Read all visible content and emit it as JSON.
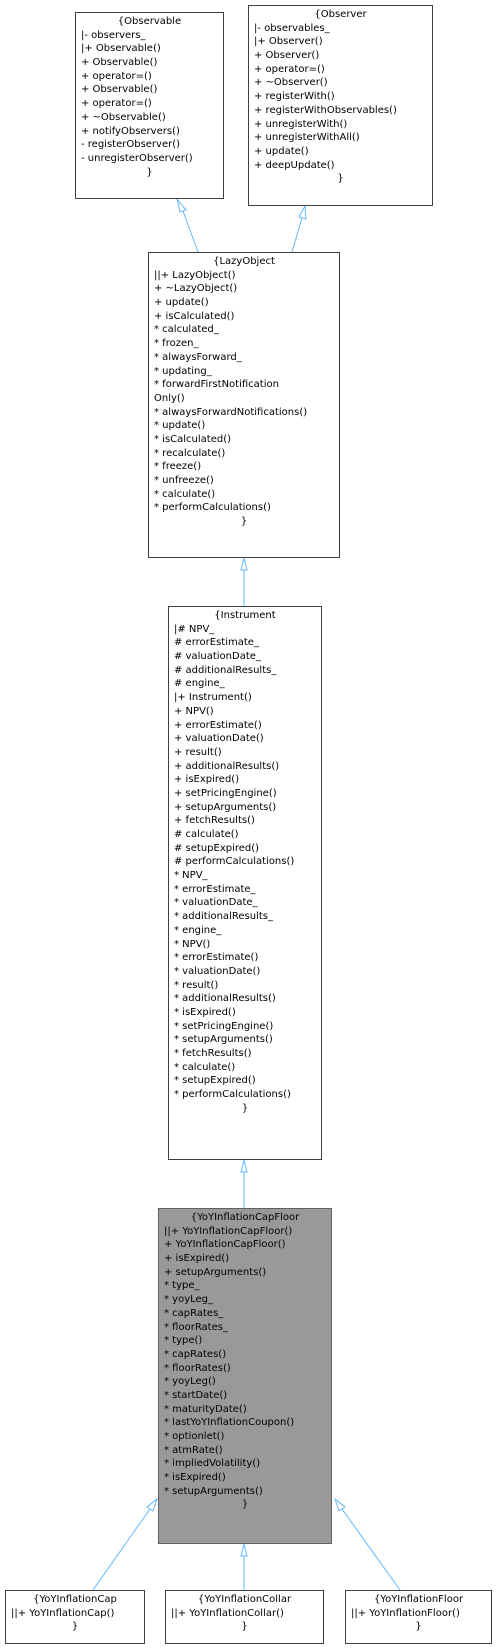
{
  "diagram": {
    "nodes": [
      {
        "id": "observable",
        "title": "{Observable",
        "members": [
          "|- observers_",
          "|+ Observable()",
          "+ Observable()",
          "+ operator=()",
          "+ Observable()",
          "+ operator=()",
          "+ ~Observable()",
          "+ notifyObservers()",
          "- registerObserver()",
          "- unregisterObserver()"
        ],
        "closer": "}"
      },
      {
        "id": "observer",
        "title": "{Observer",
        "members": [
          "|- observables_",
          "|+ Observer()",
          "+ Observer()",
          "+ operator=()",
          "+ ~Observer()",
          "+ registerWith()",
          "+ registerWithObservables()",
          "+ unregisterWith()",
          "+ unregisterWithAll()",
          "+ update()",
          "+ deepUpdate()"
        ],
        "closer": "}"
      },
      {
        "id": "lazyobject",
        "title": "{LazyObject",
        "members": [
          "||+ LazyObject()",
          "+ ~LazyObject()",
          "+ update()",
          "+ isCalculated()",
          "* calculated_",
          "* frozen_",
          "* alwaysForward_",
          "* updating_",
          "* forwardFirstNotification",
          "Only()",
          "* alwaysForwardNotifications()",
          "* update()",
          "* isCalculated()",
          "* recalculate()",
          "* freeze()",
          "* unfreeze()",
          "* calculate()",
          "* performCalculations()"
        ],
        "closer": "}"
      },
      {
        "id": "instrument",
        "title": "{Instrument",
        "members": [
          "|# NPV_",
          "# errorEstimate_",
          "# valuationDate_",
          "# additionalResults_",
          "# engine_",
          "|+ Instrument()",
          "+ NPV()",
          "+ errorEstimate()",
          "+ valuationDate()",
          "+ result()",
          "+ additionalResults()",
          "+ isExpired()",
          "+ setPricingEngine()",
          "+ setupArguments()",
          "+ fetchResults()",
          "# calculate()",
          "# setupExpired()",
          "# performCalculations()",
          "* NPV_",
          "* errorEstimate_",
          "* valuationDate_",
          "* additionalResults_",
          "* engine_",
          "* NPV()",
          "* errorEstimate()",
          "* valuationDate()",
          "* result()",
          "* additionalResults()",
          "* isExpired()",
          "* setPricingEngine()",
          "* setupArguments()",
          "* fetchResults()",
          "* calculate()",
          "* setupExpired()",
          "* performCalculations()"
        ],
        "closer": "}"
      },
      {
        "id": "yoyinflationcapfloor",
        "title": "{YoYInflationCapFloor",
        "members": [
          "||+ YoYInflationCapFloor()",
          "+ YoYInflationCapFloor()",
          "+ isExpired()",
          "+ setupArguments()",
          "* type_",
          "* yoyLeg_",
          "* capRates_",
          "* floorRates_",
          "* type()",
          "* capRates()",
          "* floorRates()",
          "* yoyLeg()",
          "* startDate()",
          "* maturityDate()",
          "* lastYoYInflationCoupon()",
          "* optionlet()",
          "* atmRate()",
          "* impliedVolatility()",
          "* isExpired()",
          "* setupArguments()"
        ],
        "closer": "}"
      },
      {
        "id": "yoyinflationcap",
        "title": "{YoYInflationCap",
        "members": [
          "||+ YoYInflationCap()"
        ],
        "closer": "}"
      },
      {
        "id": "yoyinflationcollar",
        "title": "{YoYInflationCollar",
        "members": [
          "||+ YoYInflationCollar()"
        ],
        "closer": "}"
      },
      {
        "id": "yoyinflationfloor",
        "title": "{YoYInflationFloor",
        "members": [
          "||+ YoYInflationFloor()"
        ],
        "closer": "}"
      }
    ],
    "colors": {
      "edge": "#63b8ff",
      "highlight_fill": "#999999",
      "node_border": "#404040"
    }
  }
}
